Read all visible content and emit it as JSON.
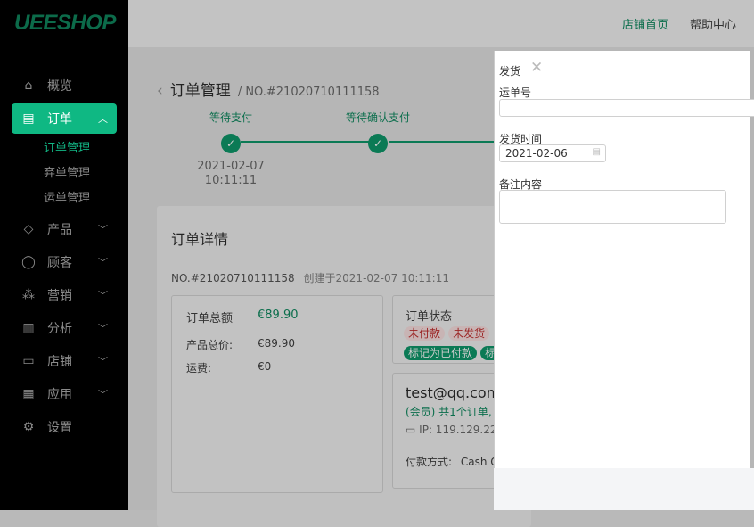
{
  "brand": "UEESHOP",
  "header": {
    "links": [
      "店铺首页",
      "帮助中心"
    ]
  },
  "sidebar": {
    "items": [
      {
        "label": "概览",
        "icon": "home-icon"
      },
      {
        "label": "订单",
        "icon": "clipboard-icon",
        "expanded": true
      },
      {
        "label": "产品",
        "icon": "cube-icon"
      },
      {
        "label": "顾客",
        "icon": "user-icon"
      },
      {
        "label": "营销",
        "icon": "share-icon"
      },
      {
        "label": "分析",
        "icon": "bar-chart-icon"
      },
      {
        "label": "店铺",
        "icon": "store-icon"
      },
      {
        "label": "应用",
        "icon": "apps-icon"
      },
      {
        "label": "设置",
        "icon": "gear-icon"
      }
    ],
    "sub": [
      "订单管理",
      "弃单管理",
      "运单管理"
    ]
  },
  "main": {
    "title": "订单管理",
    "order_no": "/ NO.#21020710111158",
    "steps": [
      "等待支付",
      "等待确认支付"
    ],
    "step_time": "2021-02-07 10:11:11",
    "detail_title": "订单详情",
    "detail_no": "NO.#21020710111158",
    "created": "创建于2021-02-07 10:11:11",
    "total_label": "订单总额",
    "total": "€89.90",
    "product_label": "产品总价:",
    "product": "€89.90",
    "ship_label": "运费:",
    "ship": "€0",
    "status_label": "订单状态",
    "status_tags": [
      "未付款",
      "未发货"
    ],
    "actions": [
      "标记为已付款",
      "标记"
    ],
    "email": "test@qq.com",
    "member": "(会员) 共1个订单,",
    "ip": "IP: 119.129.22",
    "pay_label": "付款方式:",
    "pay": "Cash O"
  },
  "drawer": {
    "title": "发货",
    "tracking_label": "运单号",
    "tracking_value": "",
    "date_label": "发货时间",
    "date_value": "2021-02-06",
    "note_label": "备注内容",
    "note_value": ""
  }
}
